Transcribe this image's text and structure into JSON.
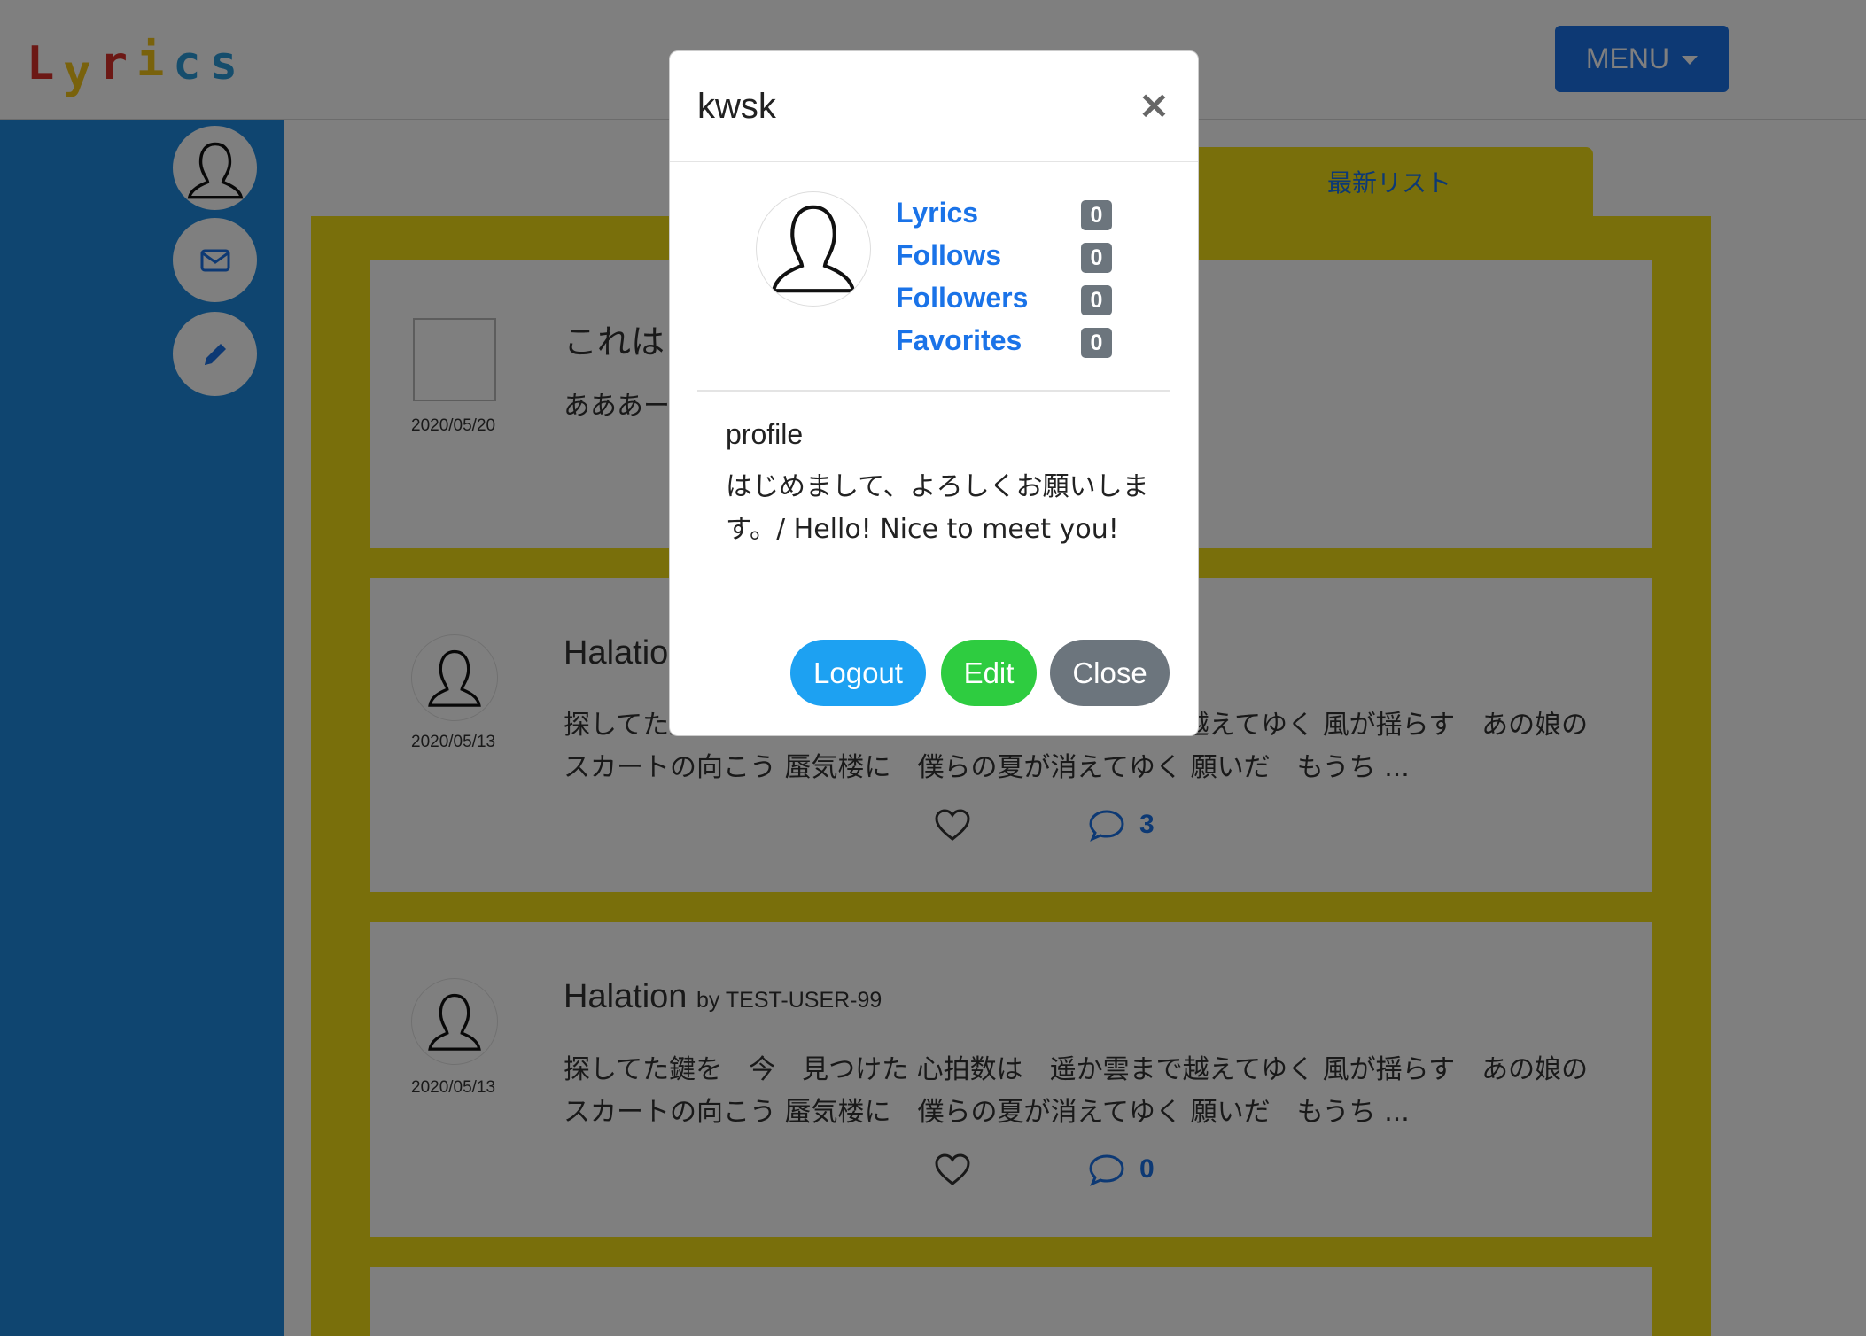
{
  "header": {
    "logo_letters": [
      "L",
      "y",
      "r",
      "i",
      "c",
      "s"
    ],
    "menu_label": "MENU"
  },
  "main": {
    "tab_label": "最新リスト",
    "cards": [
      {
        "title": "これは",
        "author": "",
        "date": "2020/05/20",
        "body": "あああー"
      },
      {
        "title": "Halatio",
        "author": "",
        "date": "2020/05/13",
        "body": "探してた鍵を　今　見つけた 心拍数は　遥か雲まで越えてゆく 風が揺らす　あの娘のスカートの向こう 蜃気楼に　僕らの夏が消えてゆく 願いだ　もうち ...",
        "comments": "3"
      },
      {
        "title": "Halation",
        "author": "by TEST-USER-99",
        "date": "2020/05/13",
        "body": "探してた鍵を　今　見つけた 心拍数は　遥か雲まで越えてゆく 風が揺らす　あの娘のスカートの向こう 蜃気楼に　僕らの夏が消えてゆく 願いだ　もうち ...",
        "comments": "0"
      }
    ]
  },
  "modal": {
    "title": "kwsk",
    "close_glyph": "×",
    "stats": [
      {
        "label": "Lyrics",
        "count": "0"
      },
      {
        "label": "Follows",
        "count": "0"
      },
      {
        "label": "Followers",
        "count": "0"
      },
      {
        "label": "Favorites",
        "count": "0"
      }
    ],
    "profile_label": "profile",
    "profile_text": "はじめまして、よろしくお願いします。/ Hello! Nice to meet you!",
    "buttons": {
      "logout": "Logout",
      "edit": "Edit",
      "close": "Close"
    }
  },
  "colors": {
    "sidebar": "#1f8be0",
    "panel": "#f2df16",
    "primary": "#1a73e8",
    "logout": "#1da1f2",
    "edit": "#2ecc40",
    "close": "#6c757d"
  }
}
